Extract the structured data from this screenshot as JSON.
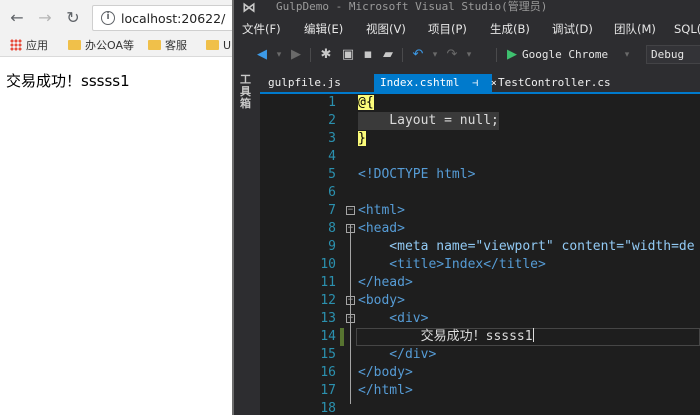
{
  "browser": {
    "nav": {
      "back_icon": "←",
      "forward_icon": "→",
      "reload_icon": "↻"
    },
    "address": {
      "info_icon": "i",
      "url": "localhost:20622/"
    },
    "bookmarks": [
      {
        "label": "应用",
        "icon": "apps-grid-icon"
      },
      {
        "label": "办公OA等",
        "icon": "folder-icon"
      },
      {
        "label": "客服",
        "icon": "folder-icon"
      },
      {
        "label": "U",
        "icon": "folder-icon"
      }
    ],
    "page_text": "交易成功！sssss1"
  },
  "vs": {
    "logo": "⋈",
    "title": "GulpDemo - Microsoft Visual Studio(管理员)",
    "menu": [
      "文件(F)",
      "编辑(E)",
      "视图(V)",
      "项目(P)",
      "生成(B)",
      "调试(D)",
      "团队(M)",
      "SQL(Q)"
    ],
    "run_target": "Google Chrome",
    "config": "Debug",
    "toolbox_label": "工具箱",
    "tabs": [
      {
        "name": "gulpfile.js",
        "active": false
      },
      {
        "name": "Index.cshtml",
        "active": true,
        "pin": "⊣",
        "close": "×"
      },
      {
        "name": "TestController.cs",
        "active": false
      }
    ],
    "editor": {
      "line_numbers": [
        "1",
        "2",
        "3",
        "4",
        "5",
        "6",
        "7",
        "8",
        "9",
        "10",
        "11",
        "12",
        "13",
        "14",
        "15",
        "16",
        "17",
        "18"
      ],
      "lines": [
        "@{",
        "    Layout = null;",
        "}",
        "",
        "<!DOCTYPE html>",
        "",
        "<html>",
        "<head>",
        "    <meta name=\"viewport\" content=\"width=de",
        "    <title>Index</title>",
        "</head>",
        "<body>",
        "    <div>",
        "        交易成功！sssss1",
        "    </div>",
        "</body>",
        "</html>",
        ""
      ]
    }
  },
  "colors": {
    "vs_background": "#2d2d30",
    "editor_background": "#1e1e1e",
    "accent": "#007acc",
    "line_number": "#2b91af",
    "tag": "#569cd6"
  }
}
